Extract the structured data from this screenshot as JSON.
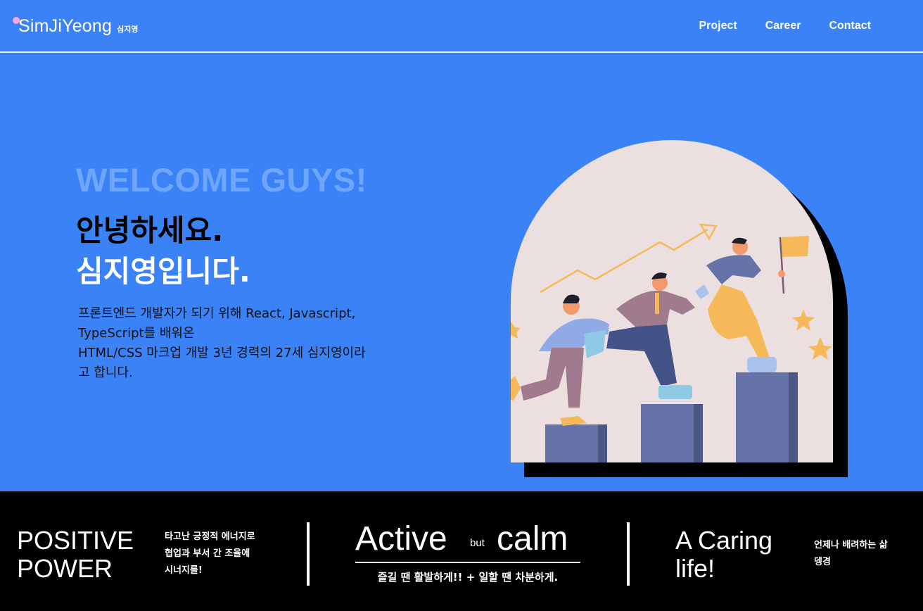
{
  "header": {
    "logo_name": "SimJiYeong",
    "logo_sub": "심지영",
    "nav": [
      "Project",
      "Career",
      "Contact"
    ]
  },
  "hero": {
    "welcome": "WELCOME GUYS!",
    "greeting_line1": "안녕하세요.",
    "greeting_line2": "심지영입니다.",
    "intro_lines": [
      "프론트엔드 개발자가 되기 위해 React, Javascript,",
      "TypeScript를 배워온",
      "HTML/CSS 마크업 개발 3년 경력의 27세 심지영이라",
      "고 합니다."
    ]
  },
  "illustration": {
    "icon": "team-climbing-stairs-illustration"
  },
  "band": {
    "positive_title": [
      "POSITIVE",
      "POWER"
    ],
    "positive_desc": [
      "타고난 긍정적 에너지로",
      "협업과 부서 간 조율에",
      "시너지를!"
    ],
    "active_word1": "Active",
    "active_but": "but",
    "active_word2": "calm",
    "active_desc": "즐길 땐 활발하게!! + 일할 땐 차분하게.",
    "caring_title": [
      "A Caring",
      "life!"
    ],
    "caring_desc": [
      "언제나 배려하는 삶",
      "뎅경"
    ]
  },
  "colors": {
    "background": "#3b82f6",
    "welcome": "#6ea6fb",
    "arch": "#ebe0df",
    "band": "#000000",
    "logo_dot": "#f9a8f0"
  }
}
